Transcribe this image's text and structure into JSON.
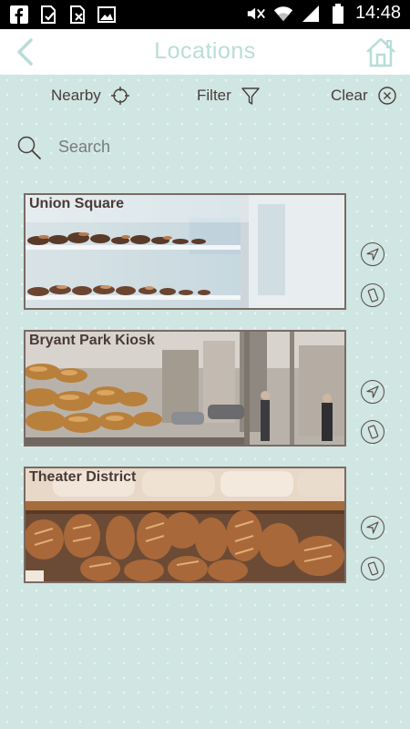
{
  "status_bar": {
    "time": "14:48",
    "left_icons": [
      "facebook-icon",
      "download-done-icon",
      "sim-off-icon",
      "image-icon"
    ],
    "right_icons": [
      "mute-icon",
      "wifi-icon",
      "signal-icon",
      "battery-icon"
    ]
  },
  "app_bar": {
    "title": "Locations",
    "back_icon": "chevron-left-icon",
    "home_icon": "home-icon"
  },
  "toolbar": {
    "nearby_label": "Nearby",
    "filter_label": "Filter",
    "clear_label": "Clear"
  },
  "search": {
    "placeholder": "Search"
  },
  "locations": [
    {
      "name": "Union Square"
    },
    {
      "name": "Bryant Park Kiosk"
    },
    {
      "name": "Theater District"
    }
  ],
  "colors": {
    "background": "#cfe6e2",
    "title_accent": "#b8ddd8",
    "text_dark": "#4b3d3a",
    "card_border": "#7a6a66"
  }
}
